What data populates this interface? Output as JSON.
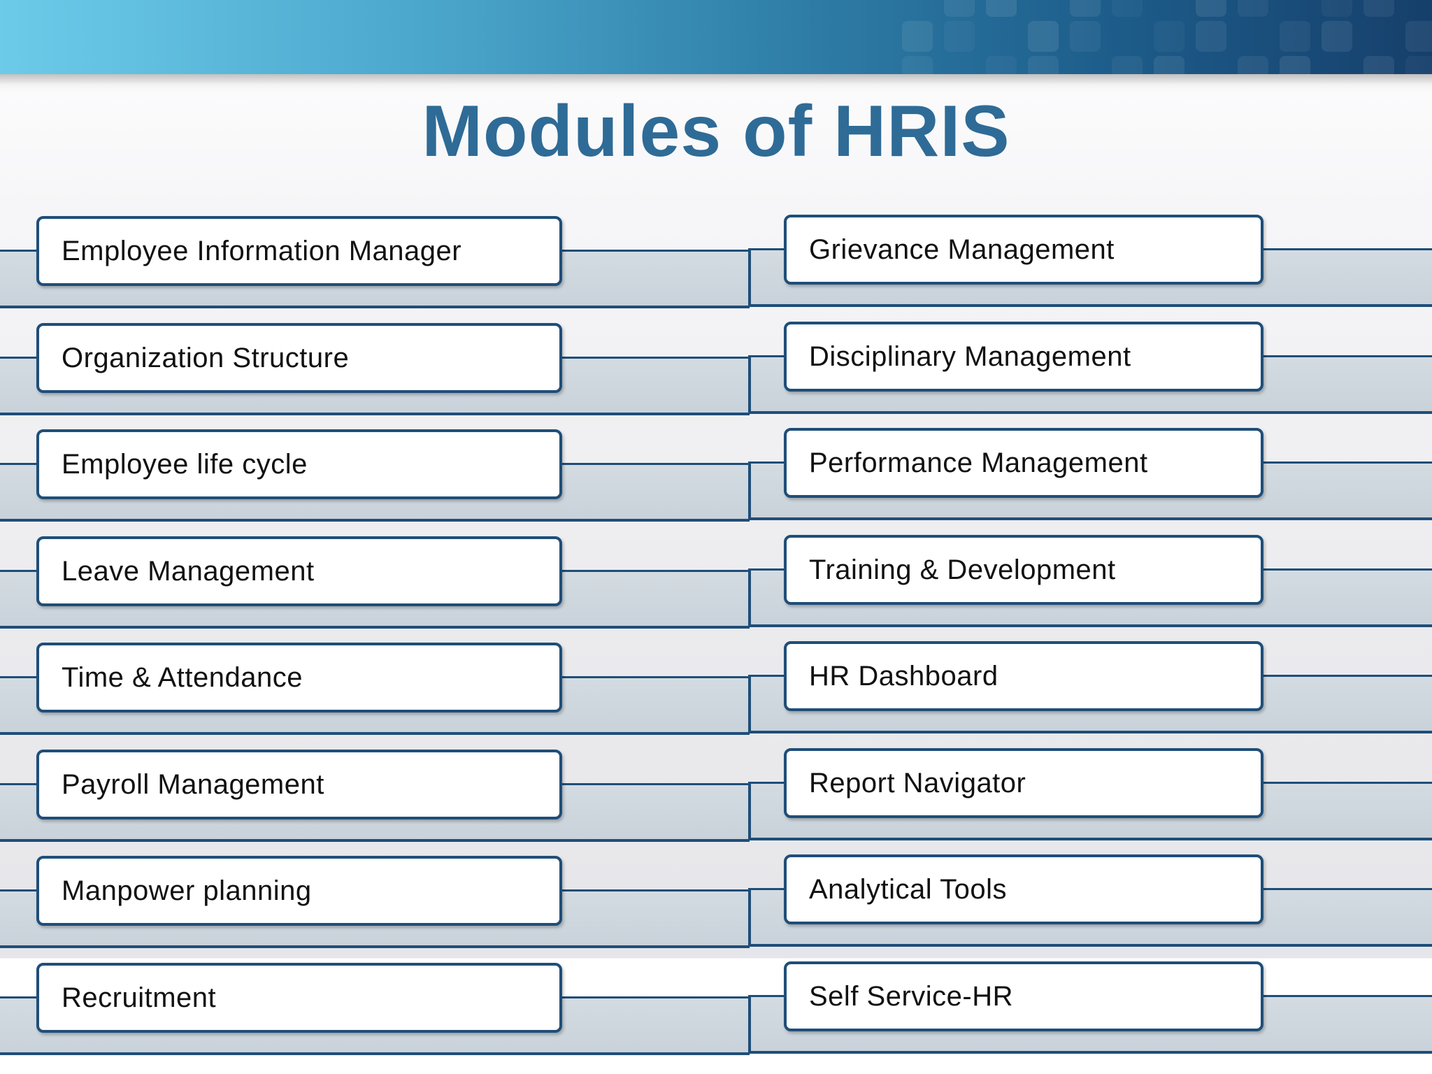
{
  "title": "Modules of HRIS",
  "colors": {
    "title": "#2e6b96",
    "box_border": "#1f4e79",
    "shelf_fill": "#c9d2da",
    "banner_start": "#6ccbe9",
    "banner_end": "#163f6b"
  },
  "modules_left": [
    {
      "label": "Employee Information Manager"
    },
    {
      "label": "Organization Structure"
    },
    {
      "label": "Employee life cycle"
    },
    {
      "label": "Leave Management"
    },
    {
      "label": "Time & Attendance"
    },
    {
      "label": "Payroll Management"
    },
    {
      "label": "Manpower planning"
    },
    {
      "label": "Recruitment"
    }
  ],
  "modules_right": [
    {
      "label": "Grievance Management"
    },
    {
      "label": "Disciplinary Management"
    },
    {
      "label": "Performance Management"
    },
    {
      "label": "Training & Development"
    },
    {
      "label": "HR Dashboard"
    },
    {
      "label": "Report Navigator"
    },
    {
      "label": "Analytical Tools"
    },
    {
      "label": "Self Service-HR"
    }
  ]
}
